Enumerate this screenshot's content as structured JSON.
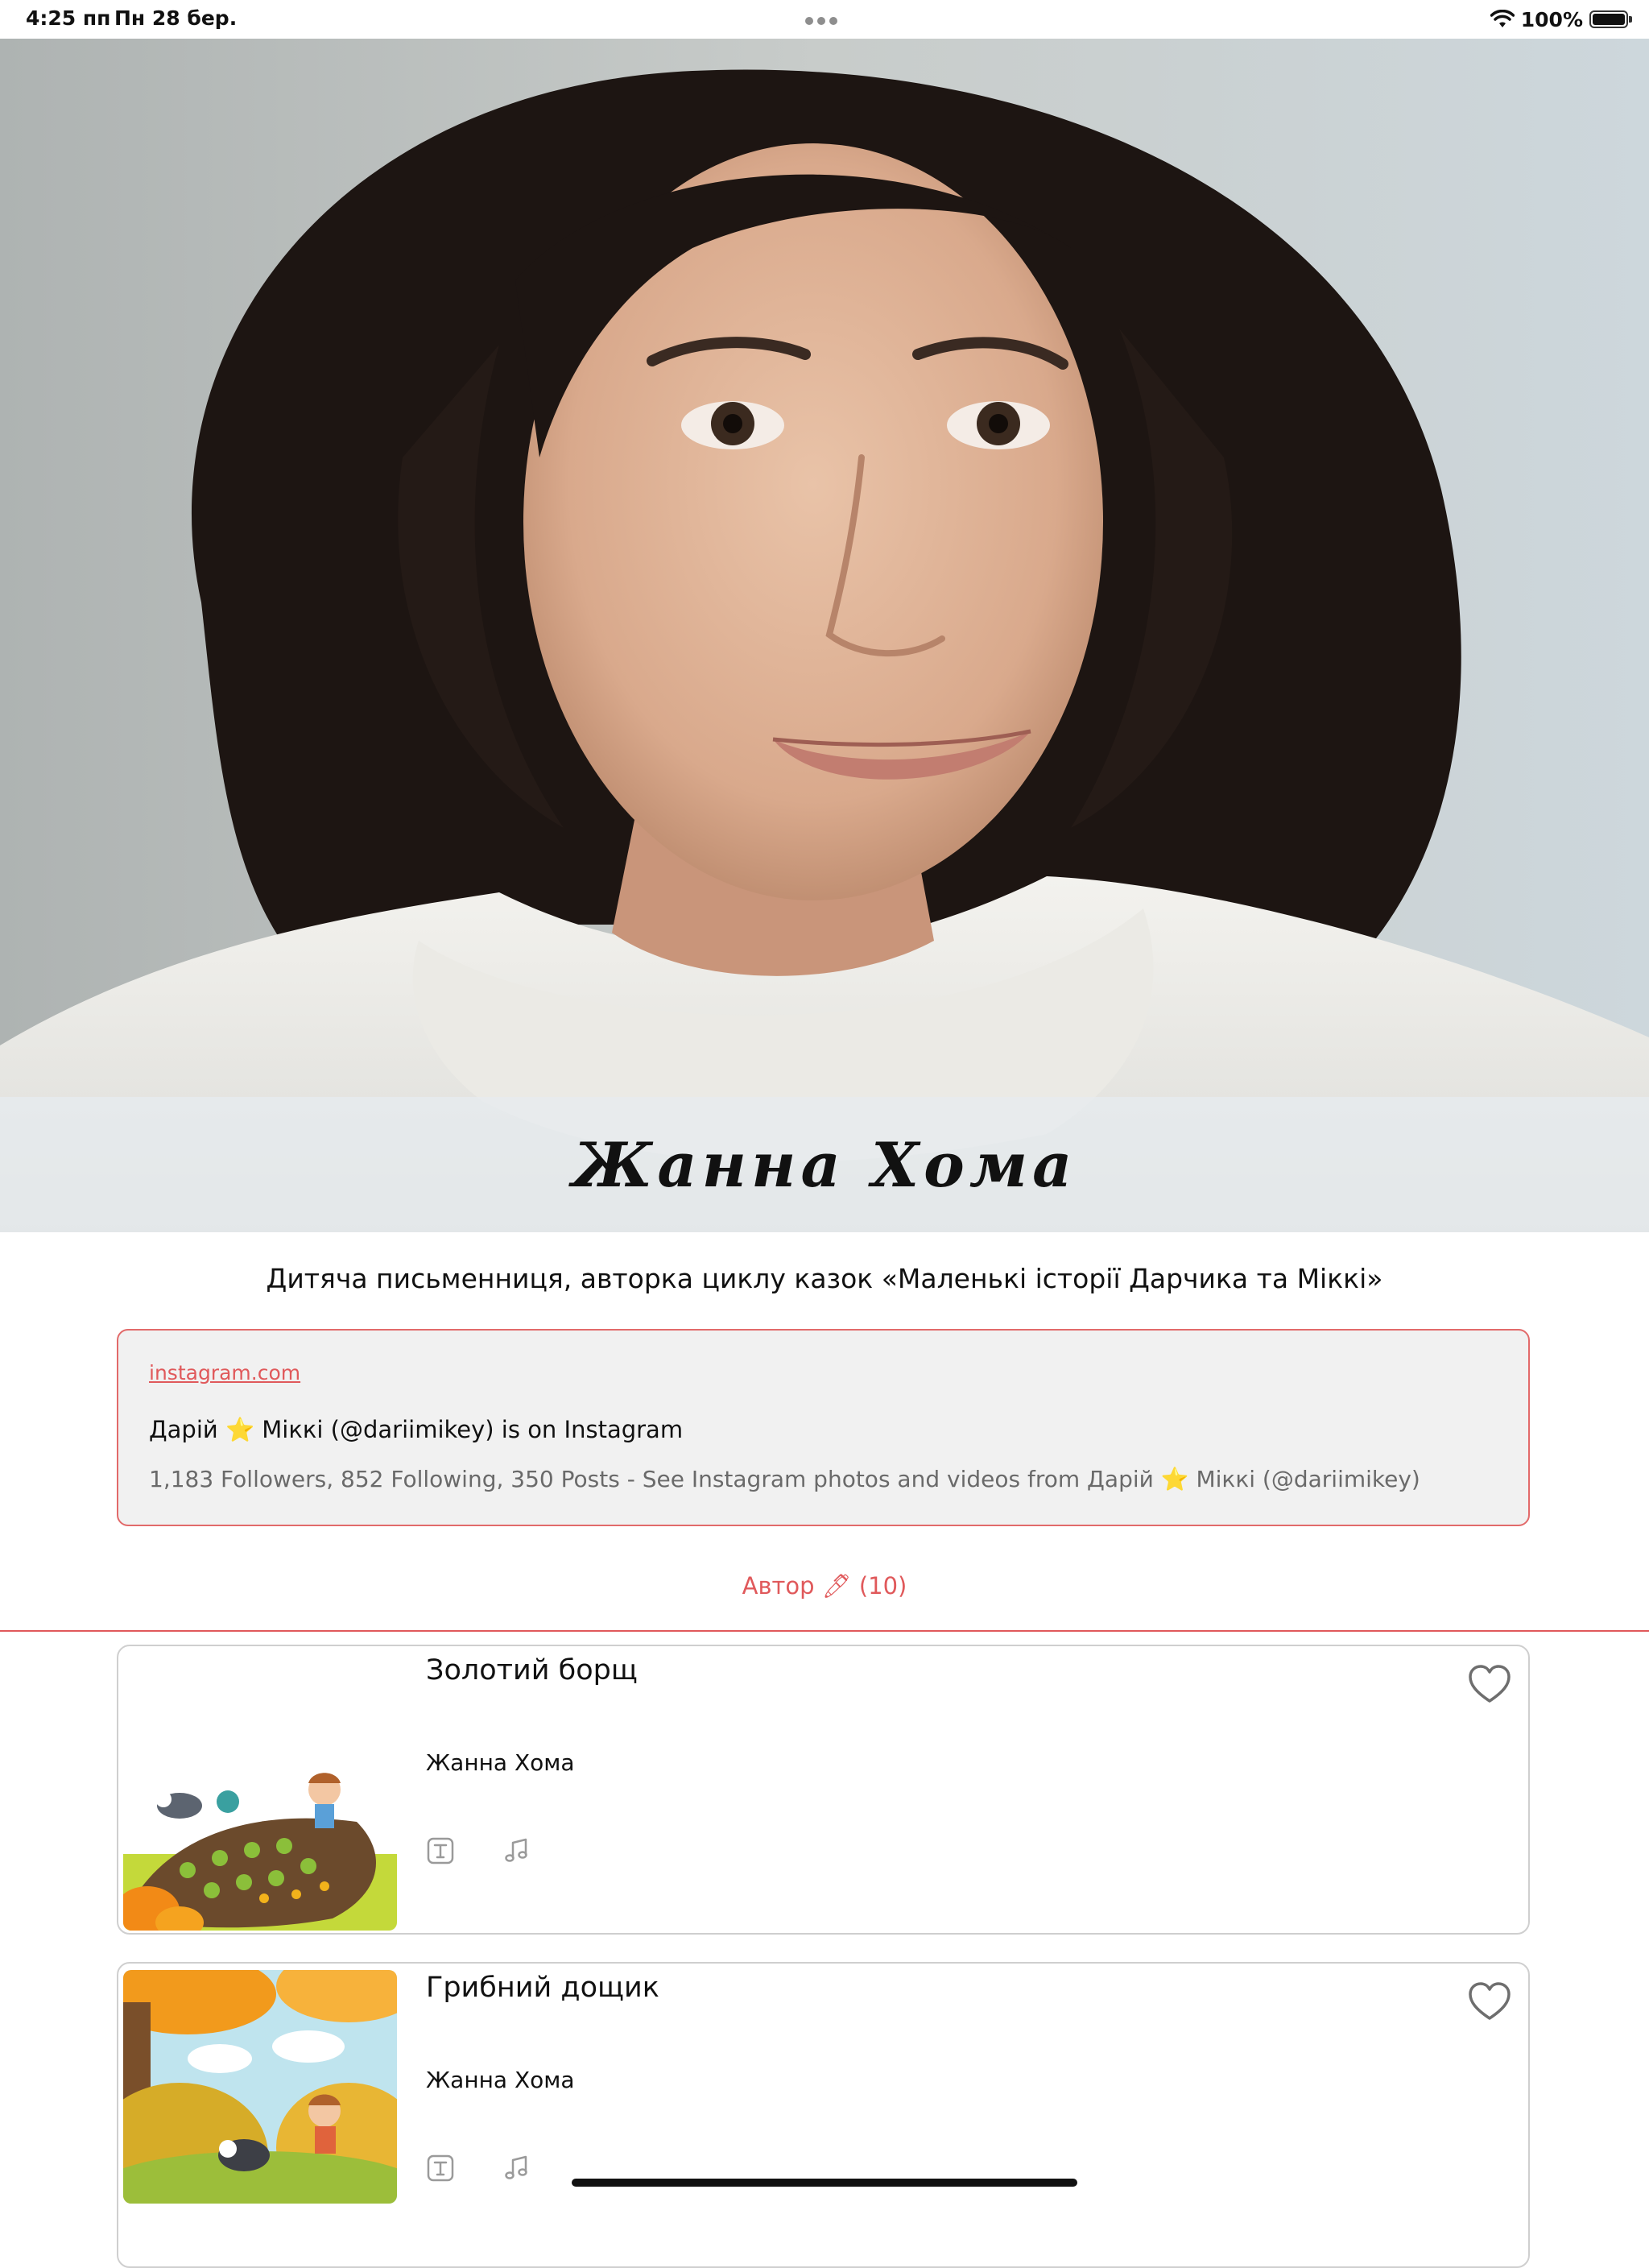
{
  "status_bar": {
    "time": "4:25 пп",
    "date": "Пн 28 бер.",
    "battery": "100%"
  },
  "author": {
    "name": "Жанна Хома",
    "bio": "Дитяча письменниця, авторка циклу казок «Маленькі історії Дарчика та Міккі»"
  },
  "link_preview": {
    "domain": "instagram.com",
    "title": "Дарій ⭐ Міккі (@dariimikey) is on Instagram",
    "description": "1,183 Followers, 852 Following, 350 Posts - See Instagram photos and videos from Дарій ⭐ Міккі (@dariimikey)"
  },
  "works_label": "Автор 🖊 (10)",
  "books": [
    {
      "title": "Золотий борщ",
      "author": "Жанна Хома",
      "formats": [
        "text-icon",
        "music-note-icon"
      ],
      "favorite_icon": "heart-outline-icon"
    },
    {
      "title": "Грибний дощик",
      "author": "Жанна Хома",
      "formats": [
        "text-icon",
        "music-note-icon"
      ],
      "favorite_icon": "heart-outline-icon"
    }
  ],
  "colors": {
    "accent": "#e0595b",
    "link_card_bg": "#f1f1f1",
    "secondary_text": "#6a6a6a"
  }
}
